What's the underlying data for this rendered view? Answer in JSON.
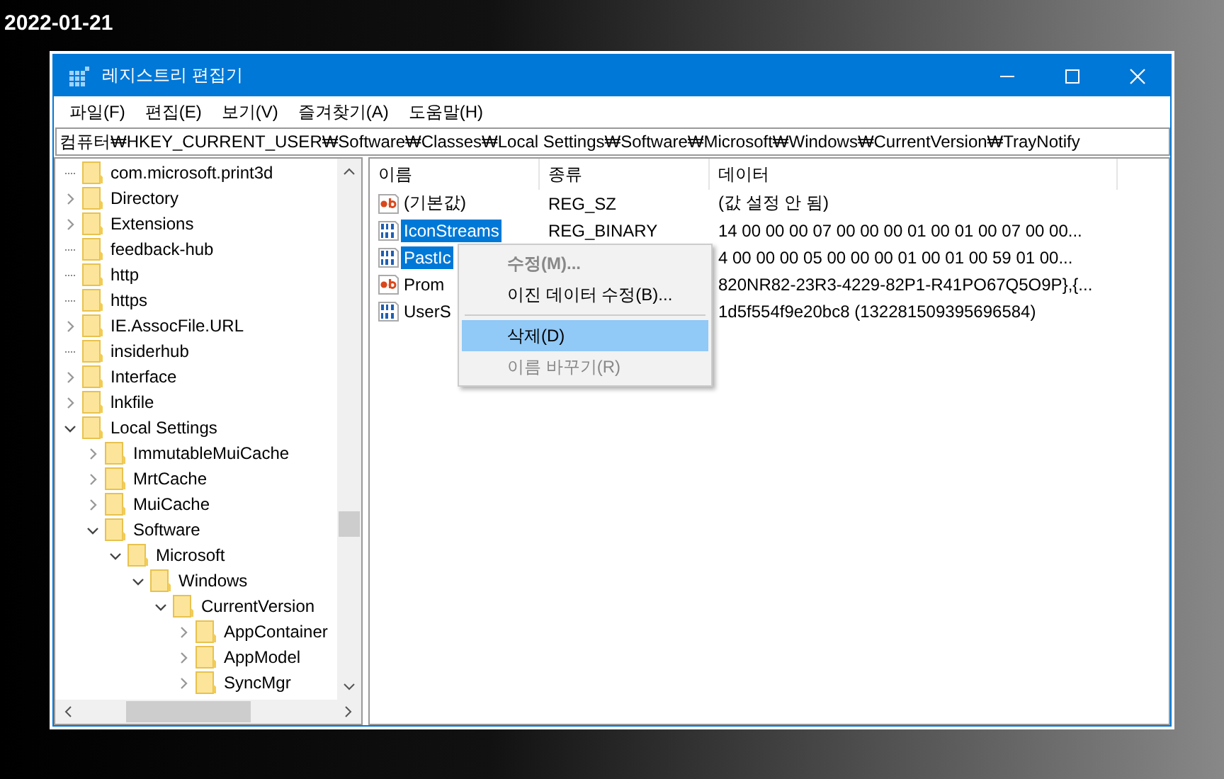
{
  "caption": "2022-01-21",
  "window": {
    "title": "레지스트리 편집기"
  },
  "menu_bar": [
    "파일(F)",
    "편집(E)",
    "보기(V)",
    "즐겨찾기(A)",
    "도움말(H)"
  ],
  "address": "컴퓨터₩HKEY_CURRENT_USER₩Software₩Classes₩Local Settings₩Software₩Microsoft₩Windows₩CurrentVersion₩TrayNotify",
  "tree": [
    {
      "label": "com.microsoft.print3d",
      "kind": "leaf"
    },
    {
      "label": "Directory",
      "kind": "branch",
      "expanded": false
    },
    {
      "label": "Extensions",
      "kind": "branch",
      "expanded": false
    },
    {
      "label": "feedback-hub",
      "kind": "leaf"
    },
    {
      "label": "http",
      "kind": "leaf"
    },
    {
      "label": "https",
      "kind": "leaf"
    },
    {
      "label": "IE.AssocFile.URL",
      "kind": "branch",
      "expanded": false
    },
    {
      "label": "insiderhub",
      "kind": "leaf"
    },
    {
      "label": "Interface",
      "kind": "branch",
      "expanded": false
    },
    {
      "label": "lnkfile",
      "kind": "branch",
      "expanded": false
    },
    {
      "label": "Local Settings",
      "kind": "branch",
      "expanded": true,
      "children": [
        {
          "label": "ImmutableMuiCache",
          "kind": "branch",
          "expanded": false
        },
        {
          "label": "MrtCache",
          "kind": "branch",
          "expanded": false
        },
        {
          "label": "MuiCache",
          "kind": "branch",
          "expanded": false
        },
        {
          "label": "Software",
          "kind": "branch",
          "expanded": true,
          "children": [
            {
              "label": "Microsoft",
              "kind": "branch",
              "expanded": true,
              "children": [
                {
                  "label": "Windows",
                  "kind": "branch",
                  "expanded": true,
                  "children": [
                    {
                      "label": "CurrentVersion",
                      "kind": "branch",
                      "expanded": true,
                      "children": [
                        {
                          "label": "AppContainer",
                          "kind": "branch",
                          "expanded": false
                        },
                        {
                          "label": "AppModel",
                          "kind": "branch",
                          "expanded": false
                        },
                        {
                          "label": "SyncMgr",
                          "kind": "branch",
                          "expanded": false
                        }
                      ]
                    }
                  ]
                }
              ]
            }
          ]
        }
      ]
    }
  ],
  "list": {
    "columns": [
      "이름",
      "종류",
      "데이터"
    ],
    "rows": [
      {
        "name": "(기본값)",
        "kind": "string",
        "type": "REG_SZ",
        "data": "(값 설정 안 됨)",
        "selected": false
      },
      {
        "name": "IconStreams",
        "kind": "binary",
        "type": "REG_BINARY",
        "data": "14 00 00 00 07 00 00 00 01 00 01 00 07 00 00...",
        "selected": true
      },
      {
        "name": "PastIc",
        "kind": "binary",
        "data": "4 00 00 00 05 00 00 00 01 00 01 00 59 01 00...",
        "selected": true
      },
      {
        "name": "Prom",
        "kind": "string",
        "data": "820NR82-23R3-4229-82P1-R41PO67Q5O9P},{...",
        "selected": false
      },
      {
        "name": "UserS",
        "kind": "binary",
        "data": "1d5f554f9e20bc8 (132281509395696584)",
        "selected": false
      }
    ]
  },
  "context_menu": [
    {
      "label": "수정(M)...",
      "kind": "item",
      "default": true,
      "disabled": true,
      "selected": false
    },
    {
      "label": "이진 데이터 수정(B)...",
      "kind": "item",
      "default": false,
      "disabled": false,
      "selected": false
    },
    {
      "kind": "separator"
    },
    {
      "label": "삭제(D)",
      "kind": "item",
      "default": false,
      "disabled": false,
      "selected": true
    },
    {
      "label": "이름 바꾸기(R)",
      "kind": "item",
      "default": false,
      "disabled": true,
      "selected": false
    }
  ]
}
